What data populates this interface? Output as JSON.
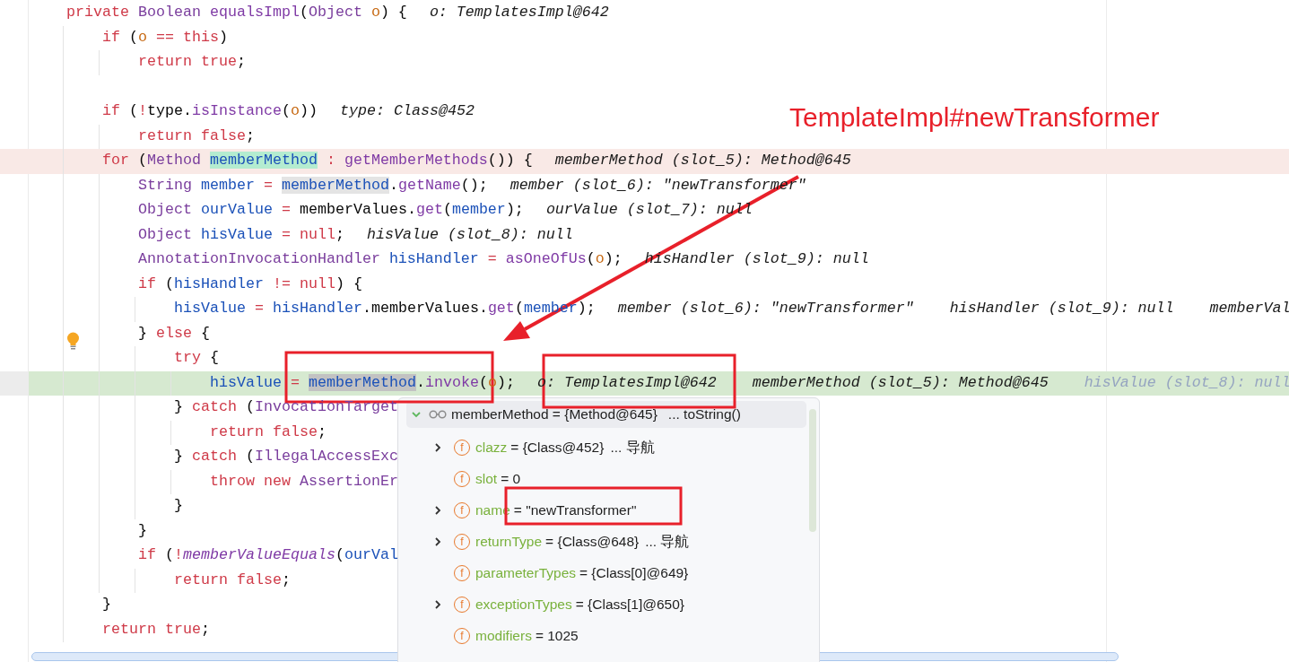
{
  "editor": {
    "lines": [
      {
        "tokens": [
          {
            "kind": "kw",
            "text": "private "
          },
          {
            "kind": "type",
            "text": "Boolean "
          },
          {
            "kind": "fn",
            "text": "equalsImpl"
          },
          {
            "kind": "plain",
            "text": "("
          },
          {
            "kind": "type",
            "text": "Object "
          },
          {
            "kind": "param",
            "text": "o"
          },
          {
            "kind": "plain",
            "text": ") {"
          }
        ],
        "hints": [
          {
            "text": "o: TemplatesImpl@642",
            "faded": false
          }
        ],
        "children": [
          {
            "tokens": [
              {
                "kind": "kw",
                "text": "if"
              },
              {
                "kind": "plain",
                "text": " ("
              },
              {
                "kind": "param",
                "text": "o "
              },
              {
                "kind": "kw",
                "text": "== this"
              },
              {
                "kind": "plain",
                "text": ")"
              }
            ],
            "children": [
              {
                "tokens": [
                  {
                    "kind": "kw",
                    "text": "return true"
                  },
                  {
                    "kind": "plain",
                    "text": ";"
                  }
                ]
              }
            ]
          },
          {
            "space_before": true,
            "tokens": [
              {
                "kind": "kw",
                "text": "if"
              },
              {
                "kind": "plain",
                "text": " ("
              },
              {
                "kind": "kw",
                "text": "!"
              },
              {
                "kind": "plain",
                "text": "type."
              },
              {
                "kind": "fn",
                "text": "isInstance"
              },
              {
                "kind": "plain",
                "text": "("
              },
              {
                "kind": "param",
                "text": "o"
              },
              {
                "kind": "plain",
                "text": "))"
              }
            ],
            "hints": [
              {
                "text": "type: Class@452",
                "faded": false
              }
            ],
            "children": [
              {
                "tokens": [
                  {
                    "kind": "kw",
                    "text": "return false"
                  },
                  {
                    "kind": "plain",
                    "text": ";"
                  }
                ]
              }
            ]
          },
          {
            "visited": true,
            "tokens": [
              {
                "kind": "kw",
                "text": "for"
              },
              {
                "kind": "plain",
                "text": " ("
              },
              {
                "kind": "type",
                "text": "Method "
              },
              {
                "kind": "local",
                "text": "memberMethod",
                "color": "#b4ecd0"
              },
              {
                "kind": "kw",
                "text": " : "
              },
              {
                "kind": "fn",
                "text": "getMemberMethods"
              },
              {
                "kind": "plain",
                "text": "()) {"
              }
            ],
            "hints": [
              {
                "text": "memberMethod (slot_5): Method@645",
                "faded": false
              }
            ],
            "children": [
              {
                "tokens": [
                  {
                    "kind": "type",
                    "text": "String "
                  },
                  {
                    "kind": "local",
                    "text": "member "
                  },
                  {
                    "kind": "kw",
                    "text": "= "
                  },
                  {
                    "kind": "local",
                    "text": "memberMethod",
                    "color": "#e4e4e4"
                  },
                  {
                    "kind": "plain",
                    "text": "."
                  },
                  {
                    "kind": "fn",
                    "text": "getName"
                  },
                  {
                    "kind": "plain",
                    "text": "();"
                  }
                ],
                "hints": [
                  {
                    "text": "member (slot_6): \"newTransformer\"",
                    "faded": false
                  }
                ]
              },
              {
                "tokens": [
                  {
                    "kind": "type",
                    "text": "Object "
                  },
                  {
                    "kind": "local",
                    "text": "ourValue "
                  },
                  {
                    "kind": "kw",
                    "text": "= "
                  },
                  {
                    "kind": "plain",
                    "text": "memberValues."
                  },
                  {
                    "kind": "fn",
                    "text": "get"
                  },
                  {
                    "kind": "plain",
                    "text": "("
                  },
                  {
                    "kind": "local",
                    "text": "member"
                  },
                  {
                    "kind": "plain",
                    "text": ");"
                  }
                ],
                "hints": [
                  {
                    "text": "ourValue (slot_7): null",
                    "faded": false
                  }
                ]
              },
              {
                "tokens": [
                  {
                    "kind": "type",
                    "text": "Object "
                  },
                  {
                    "kind": "local",
                    "text": "hisValue "
                  },
                  {
                    "kind": "kw",
                    "text": "= null"
                  },
                  {
                    "kind": "plain",
                    "text": ";"
                  }
                ],
                "hints": [
                  {
                    "text": "hisValue (slot_8): null",
                    "faded": false
                  }
                ]
              },
              {
                "tokens": [
                  {
                    "kind": "type",
                    "text": "AnnotationInvocationHandler "
                  },
                  {
                    "kind": "local",
                    "text": "hisHandler "
                  },
                  {
                    "kind": "kw",
                    "text": "= "
                  },
                  {
                    "kind": "fn",
                    "text": "asOneOfUs"
                  },
                  {
                    "kind": "plain",
                    "text": "("
                  },
                  {
                    "kind": "param",
                    "text": "o"
                  },
                  {
                    "kind": "plain",
                    "text": ");"
                  }
                ],
                "hints": [
                  {
                    "text": "hisHandler (slot_9): null",
                    "faded": false
                  }
                ]
              },
              {
                "tokens": [
                  {
                    "kind": "kw",
                    "text": "if"
                  },
                  {
                    "kind": "plain",
                    "text": " ("
                  },
                  {
                    "kind": "local",
                    "text": "hisHandler "
                  },
                  {
                    "kind": "kw",
                    "text": "!= null"
                  },
                  {
                    "kind": "plain",
                    "text": ") {"
                  }
                ],
                "children": [
                  {
                    "tokens": [
                      {
                        "kind": "local",
                        "text": "hisValue "
                      },
                      {
                        "kind": "kw",
                        "text": "= "
                      },
                      {
                        "kind": "local",
                        "text": "hisHandler"
                      },
                      {
                        "kind": "plain",
                        "text": ".memberValues."
                      },
                      {
                        "kind": "fn",
                        "text": "get"
                      },
                      {
                        "kind": "plain",
                        "text": "("
                      },
                      {
                        "kind": "local",
                        "text": "member"
                      },
                      {
                        "kind": "plain",
                        "text": ");"
                      }
                    ],
                    "hints": [
                      {
                        "text": "member (slot_6): \"newTransformer\"",
                        "faded": false
                      },
                      {
                        "text": "hisHandler (slot_9): null",
                        "faded": false
                      },
                      {
                        "text": "memberVal",
                        "faded": false
                      }
                    ]
                  }
                ]
              },
              {
                "tokens": [
                  {
                    "kind": "plain",
                    "text": "} "
                  },
                  {
                    "kind": "kw",
                    "text": "else"
                  },
                  {
                    "kind": "plain",
                    "text": " {"
                  }
                ],
                "children": [
                  {
                    "bulb": true,
                    "tokens": [
                      {
                        "kind": "kw",
                        "text": "try"
                      },
                      {
                        "kind": "plain",
                        "text": " {"
                      }
                    ],
                    "children": [
                      {
                        "execution": true,
                        "tokens": [
                          {
                            "kind": "local",
                            "text": "hisValue "
                          },
                          {
                            "kind": "kw",
                            "text": "= "
                          },
                          {
                            "kind": "local",
                            "text": "memberMethod",
                            "color": "#c2c2c2"
                          },
                          {
                            "kind": "plain",
                            "text": "."
                          },
                          {
                            "kind": "fn",
                            "text": "invoke"
                          },
                          {
                            "kind": "plain",
                            "text": "("
                          },
                          {
                            "kind": "param",
                            "text": "o"
                          },
                          {
                            "kind": "plain",
                            "text": ");"
                          }
                        ],
                        "hints": [
                          {
                            "text": "o: TemplatesImpl@642",
                            "faded": false
                          },
                          {
                            "text": "memberMethod (slot_5): Method@645",
                            "faded": false
                          },
                          {
                            "text": "hisValue (slot_8): null",
                            "faded": true
                          }
                        ]
                      }
                    ]
                  },
                  {
                    "tokens": [
                      {
                        "kind": "plain",
                        "text": "} "
                      },
                      {
                        "kind": "kw",
                        "text": "catch"
                      },
                      {
                        "kind": "plain",
                        "text": " ("
                      },
                      {
                        "kind": "type",
                        "text": "InvocationTarget"
                      }
                    ],
                    "children": [
                      {
                        "tokens": [
                          {
                            "kind": "kw",
                            "text": "return false"
                          },
                          {
                            "kind": "plain",
                            "text": ";"
                          }
                        ]
                      }
                    ]
                  },
                  {
                    "tokens": [
                      {
                        "kind": "plain",
                        "text": "} "
                      },
                      {
                        "kind": "kw",
                        "text": "catch"
                      },
                      {
                        "kind": "plain",
                        "text": " ("
                      },
                      {
                        "kind": "type",
                        "text": "IllegalAccessExc"
                      }
                    ],
                    "children": [
                      {
                        "tokens": [
                          {
                            "kind": "kw",
                            "text": "throw new "
                          },
                          {
                            "kind": "type",
                            "text": "AssertionEr"
                          }
                        ]
                      }
                    ]
                  },
                  {
                    "tokens": [
                      {
                        "kind": "plain",
                        "text": "}"
                      }
                    ]
                  }
                ]
              },
              {
                "tokens": [
                  {
                    "kind": "plain",
                    "text": "}"
                  }
                ]
              },
              {
                "tokens": [
                  {
                    "kind": "kw",
                    "text": "if"
                  },
                  {
                    "kind": "plain",
                    "text": " ("
                  },
                  {
                    "kind": "kw",
                    "text": "!"
                  },
                  {
                    "kind": "fn-static",
                    "text": "memberValueEquals"
                  },
                  {
                    "kind": "plain",
                    "text": "("
                  },
                  {
                    "kind": "local",
                    "text": "ourVal"
                  }
                ],
                "children": [
                  {
                    "tokens": [
                      {
                        "kind": "kw",
                        "text": "return false"
                      },
                      {
                        "kind": "plain",
                        "text": ";"
                      }
                    ]
                  }
                ]
              }
            ]
          },
          {
            "tokens": [
              {
                "kind": "plain",
                "text": "}"
              }
            ]
          },
          {
            "tokens": [
              {
                "kind": "kw",
                "text": "return true"
              },
              {
                "kind": "plain",
                "text": ";"
              }
            ]
          }
        ]
      }
    ]
  },
  "debug_popup": {
    "header": {
      "name": "memberMethod",
      "value": "= {Method@645}",
      "extra": "... toString()",
      "expanded": true
    },
    "fields": [
      {
        "badge": "f",
        "name": "clazz",
        "value": "= {Class@452}",
        "extra": "... 导航",
        "expandable": true
      },
      {
        "badge": "f",
        "name": "slot",
        "value": "= 0",
        "expandable": false
      },
      {
        "badge": "f",
        "name": "name",
        "value": "= \"newTransformer\"",
        "expandable": true
      },
      {
        "badge": "f",
        "name": "returnType",
        "value": "= {Class@648}",
        "extra": "... 导航",
        "expandable": true
      },
      {
        "badge": "f",
        "name": "parameterTypes",
        "value": "= {Class[0]@649}",
        "expandable": false
      },
      {
        "badge": "f",
        "name": "exceptionTypes",
        "value": "= {Class[1]@650}",
        "expandable": true
      },
      {
        "badge": "f",
        "name": "modifiers",
        "value": "= 1025",
        "expandable": false
      }
    ]
  },
  "annotation": {
    "label": "TemplateImpl#newTransformer"
  }
}
